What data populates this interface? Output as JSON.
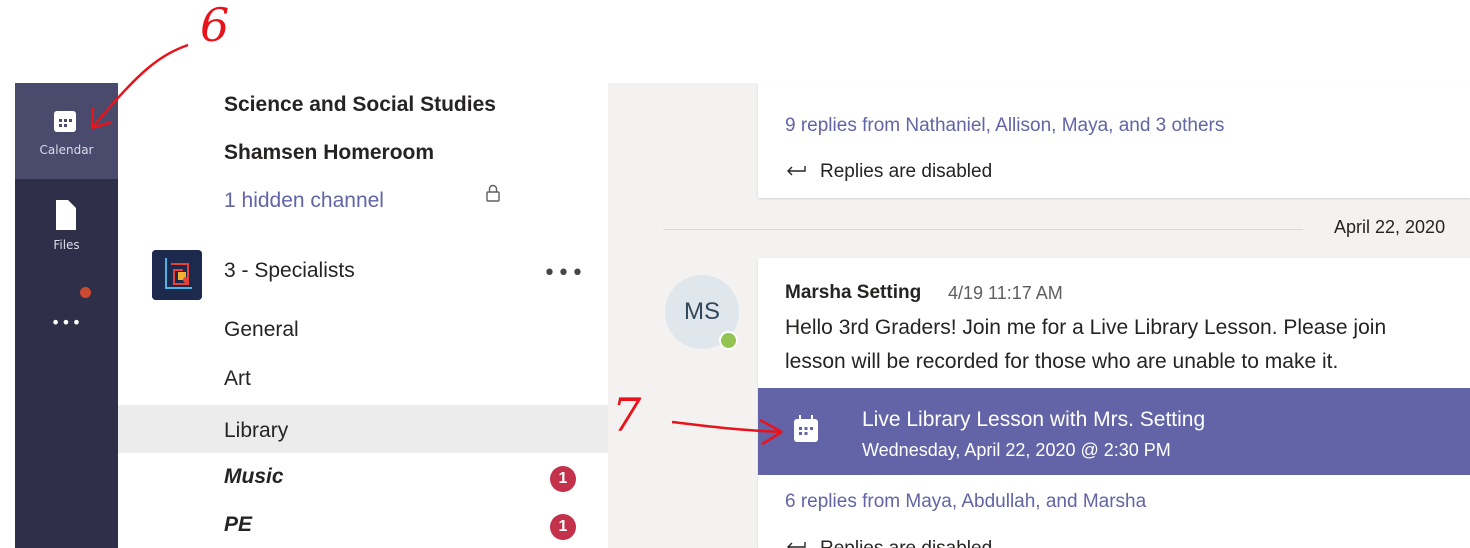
{
  "rail": {
    "calendar_label": "Calendar",
    "files_label": "Files",
    "more_label": "•••"
  },
  "channels": {
    "team_science": "Science and Social Studies",
    "team_homeroom": "Shamsen Homeroom",
    "hidden_channels": "1 hidden channel",
    "team_specialists": "3 - Specialists",
    "more_options": "•••",
    "items": [
      {
        "label": "General"
      },
      {
        "label": "Art"
      },
      {
        "label": "Library"
      },
      {
        "label": "Music",
        "badge": "1"
      },
      {
        "label": "PE",
        "badge": "1"
      }
    ]
  },
  "conversation": {
    "top_replies": "9 replies from Nathaniel, Allison, Maya, and 3 others",
    "replies_disabled": "Replies are disabled",
    "date_separator": "April 22, 2020",
    "avatar_initials": "MS",
    "sender": "Marsha Setting",
    "timestamp": "4/19 11:17 AM",
    "message_line1": "Hello 3rd Graders! Join me for a Live Library Lesson. Please join",
    "message_line2": "lesson will be recorded for those who are unable to make it.",
    "event_title": "Live Library Lesson with Mrs. Setting",
    "event_datetime": "Wednesday, April 22, 2020 @ 2:30 PM",
    "bottom_replies": "6 replies from Maya, Abdullah, and Marsha",
    "bottom_replies_disabled": "Replies are disabled"
  },
  "annotations": {
    "step6": "6",
    "step7": "7",
    "color": "#e8131b"
  },
  "colors": {
    "rail": "#2f2f4a",
    "accent": "#6264a7",
    "badge": "#c4314b",
    "presence": "#92c353"
  }
}
